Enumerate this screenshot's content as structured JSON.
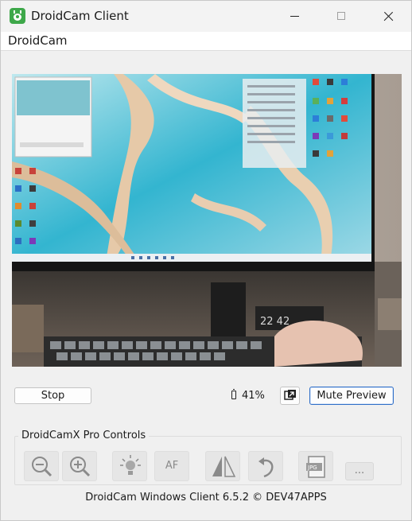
{
  "window": {
    "title": "DroidCam Client"
  },
  "menu": {
    "items": [
      "DroidCam"
    ]
  },
  "controls": {
    "stop_label": "Stop",
    "battery": "41%",
    "mute_label": "Mute Preview"
  },
  "pro_controls": {
    "title": "DroidCamX Pro Controls",
    "af_label": "AF",
    "more_label": "..."
  },
  "footer": "DroidCam Windows Client 6.5.2 © DEV47APPS",
  "icons": [
    "droidcam-app-icon",
    "minimize-icon",
    "maximize-icon",
    "close-icon",
    "battery-icon",
    "picture-in-picture-icon",
    "zoom-out-icon",
    "zoom-in-icon",
    "brightness-icon",
    "mirror-flip-icon",
    "rotate-icon",
    "jpg-snapshot-icon"
  ],
  "colors": {
    "accent": "#2f6fc8",
    "app_icon": "#3ea84a"
  }
}
